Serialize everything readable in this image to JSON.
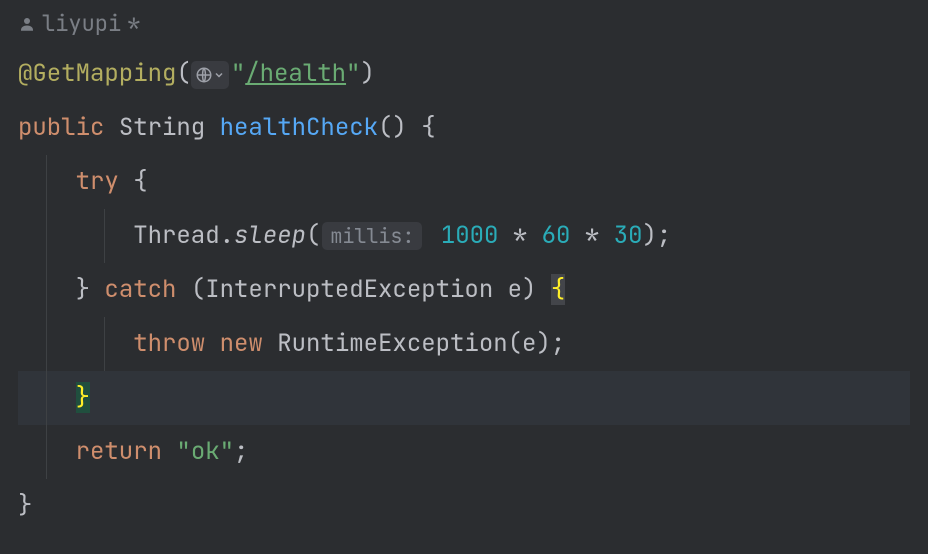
{
  "author": {
    "name": "liyupi",
    "suffix": " *"
  },
  "icons": {
    "author": "person-icon",
    "url": "globe-icon",
    "chevron": "chevron-down-icon"
  },
  "code": {
    "annotation": "@GetMapping",
    "url_path": "/health",
    "quote": "\"",
    "kw_public": "public",
    "type_string": "String",
    "method_name": "healthCheck",
    "parens_empty": "()",
    "brace_open": "{",
    "brace_close": "}",
    "kw_try": "try",
    "thread_class": "Thread",
    "dot": ".",
    "sleep_name": "sleep",
    "param_hint_label": "millis:",
    "n1000": "1000",
    "star": "*",
    "n60": "60",
    "n30": "30",
    "semi": ";",
    "kw_catch": "catch",
    "exc_type": "InterruptedException",
    "exc_var": "e",
    "kw_throw": "throw",
    "kw_new": "new",
    "runtime_exc": "RuntimeException",
    "kw_return": "return",
    "ok_str": "ok"
  }
}
